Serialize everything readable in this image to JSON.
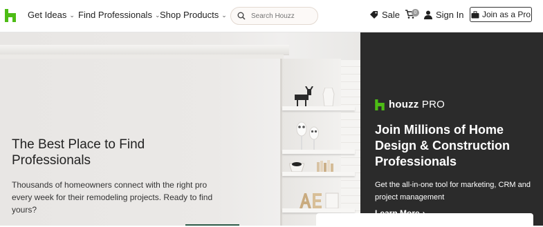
{
  "colors": {
    "brand_green": "#4dbc15",
    "pro_bg": "#2b2b2b",
    "cta_green": "#2d5a47"
  },
  "nav": {
    "items": [
      {
        "label": "Get Ideas",
        "icon": "chevron-down-icon"
      },
      {
        "label": "Find Professionals",
        "icon": "chevron-down-icon"
      },
      {
        "label": "Shop Products",
        "icon": "chevron-down-icon"
      }
    ],
    "search": {
      "placeholder": "Search Houzz",
      "icon": "search-icon"
    },
    "sale_label": "Sale",
    "cart_count": "0",
    "sign_in_label": "Sign In",
    "join_label": "Join as a Pro"
  },
  "hero": {
    "title": "The Best Place to Find Professionals",
    "description": "Thousands of homeowners connect with the right pro every week for their remodeling projects. Ready to find yours?"
  },
  "pro": {
    "brand": "houzz",
    "brand_tag": "PRO",
    "title": "Join Millions of Home Design & Construction Professionals",
    "description": "Get the all-in-one tool for marketing, CRM and project management",
    "learn_more": "Learn More"
  }
}
